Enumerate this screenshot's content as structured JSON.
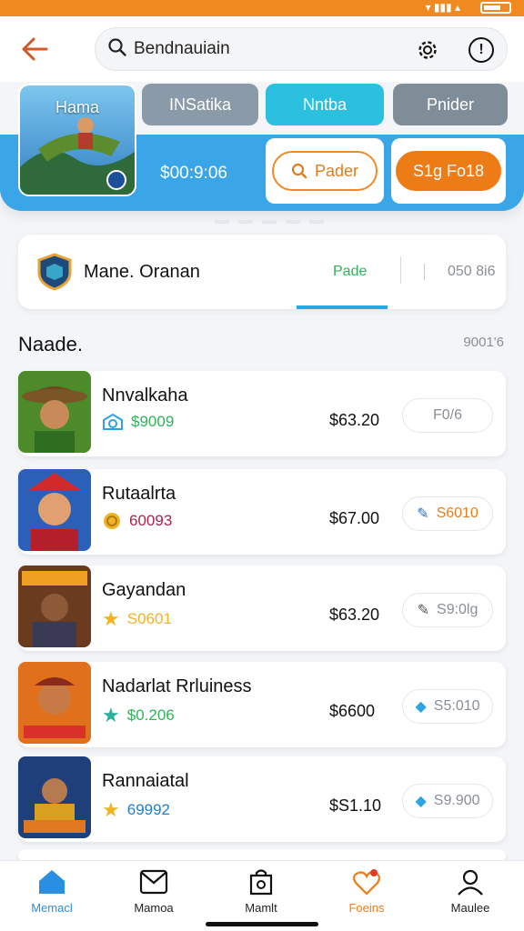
{
  "search": {
    "value": "Bendnauiain"
  },
  "hero": {
    "image_label": "Hama",
    "chips": [
      "INSatika",
      "Nntba",
      "Pnider"
    ],
    "price": "$00:9:06",
    "outline_button": "Pader",
    "solid_button": "S1g Fo18"
  },
  "profile": {
    "name": "Mane. Oranan",
    "tab_active": "Pade",
    "tab_other": "050 8i6"
  },
  "section": {
    "title": "Naade.",
    "count": "9001'6"
  },
  "items": [
    {
      "title": "Nnvalkaha",
      "rating": "$9009",
      "rating_color": "#2fb35a",
      "price": "$63.20",
      "action": "F0/6"
    },
    {
      "title": "Rutaalrta",
      "rating": "60093",
      "rating_color": "#b0204a",
      "price": "$67.00",
      "action": "S6010"
    },
    {
      "title": "Gayandan",
      "rating": "S0601",
      "rating_color": "#f0b323",
      "price": "$63.20",
      "action": "S9:0lg"
    },
    {
      "title": "Nadarlat Rrluiness",
      "rating": "$0.206",
      "rating_color": "#2fb35a",
      "price": "$6600",
      "action": "S5:010"
    },
    {
      "title": "Rannaiatal",
      "rating": "69992",
      "rating_color": "#1e7ed0",
      "price": "$S1.10",
      "action": "S9.900"
    }
  ],
  "nav": [
    "Memacl",
    "Mamoa",
    "Mamlt",
    "Foeins",
    "Maulee"
  ],
  "colors": {
    "accent": "#ee7c16",
    "blue": "#3aa6e8",
    "green": "#2fb35a"
  }
}
